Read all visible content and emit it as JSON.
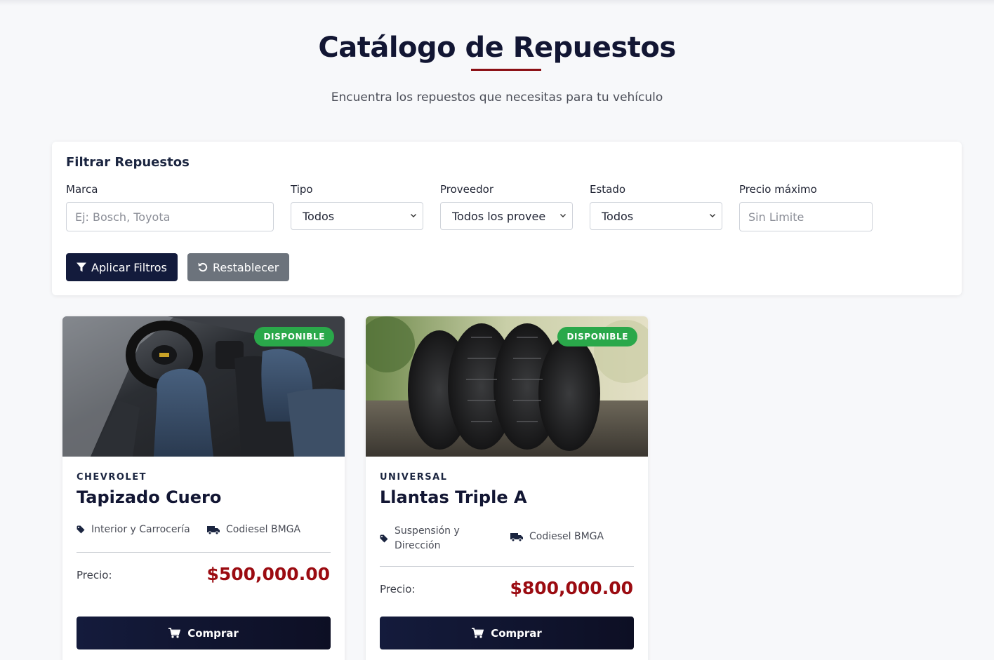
{
  "header": {
    "title": "Catálogo de Repuestos",
    "subtitle": "Encuentra los repuestos que necesitas para tu vehículo"
  },
  "filters": {
    "title": "Filtrar Repuestos",
    "marca": {
      "label": "Marca",
      "placeholder": "Ej: Bosch, Toyota"
    },
    "tipo": {
      "label": "Tipo",
      "value": "Todos"
    },
    "proveedor": {
      "label": "Proveedor",
      "value": "Todos los proveedores"
    },
    "estado": {
      "label": "Estado",
      "value": "Todos"
    },
    "precio": {
      "label": "Precio máximo",
      "placeholder": "Sin Limite"
    },
    "apply_label": "Aplicar Filtros",
    "reset_label": "Restablecer"
  },
  "products": [
    {
      "badge": "DISPONIBLE",
      "brand": "CHEVROLET",
      "name": "Tapizado Cuero",
      "category": "Interior y Carrocería",
      "supplier": "Codiesel BMGA",
      "price_label": "Precio:",
      "price": "$500,000.00",
      "buy_label": "Comprar"
    },
    {
      "badge": "DISPONIBLE",
      "brand": "UNIVERSAL",
      "name": "Llantas Triple A",
      "category_line1": "Suspensión y",
      "category_line2": "Dirección",
      "supplier": "Codiesel BMGA",
      "price_label": "Precio:",
      "price": "$800,000.00",
      "buy_label": "Comprar"
    }
  ],
  "colors": {
    "navy": "#131b3c",
    "accent_red": "#9b0b11",
    "badge_green": "#2aa84a",
    "reset_gray": "#6c737c"
  },
  "icons": {
    "apply": "filter-icon",
    "reset": "undo-icon",
    "category": "tag-icon",
    "supplier": "truck-icon",
    "buy": "cart-icon",
    "select": "chevron-down-icon"
  }
}
